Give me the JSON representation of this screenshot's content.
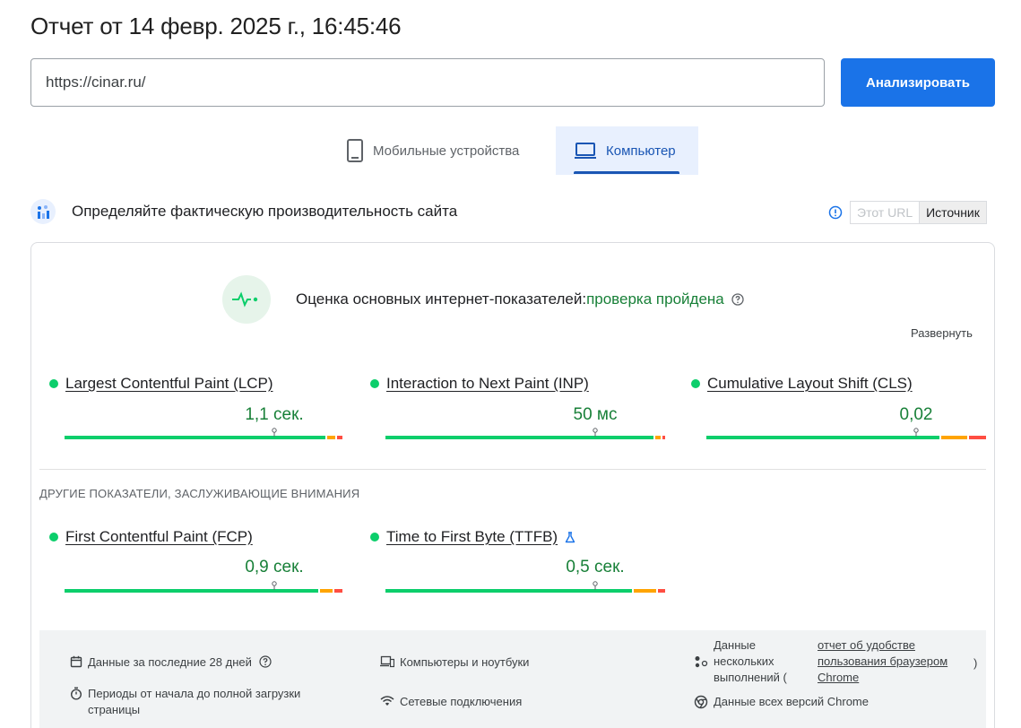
{
  "report": {
    "title": "Отчет от 14 февр. 2025 г., 16:45:46"
  },
  "search": {
    "url": "https://cinar.ru/",
    "analyze_label": "Анализировать"
  },
  "tabs": [
    {
      "label": "Мобильные устройства",
      "icon": "smartphone-icon",
      "active": false
    },
    {
      "label": "Компьютер",
      "icon": "laptop-icon",
      "active": true
    }
  ],
  "section": {
    "title": "Определяйте фактическую производительность сайта",
    "toggle": {
      "this_url": "Этот URL",
      "origin": "Источник",
      "selected": "Источник"
    }
  },
  "cwv": {
    "label": "Оценка основных интернет-показателей:",
    "status": "проверка пройдена",
    "expand": "Развернуть"
  },
  "metrics": [
    {
      "name": "Largest Contentful Paint (LCP)",
      "value": "1,1 сек.",
      "rating": "good",
      "marker_fraction": 0.75
    },
    {
      "name": "Interaction to Next Paint (INP)",
      "value": "50 мс",
      "rating": "good",
      "marker_fraction": 0.75
    },
    {
      "name": "Cumulative Layout Shift (CLS)",
      "value": "0,02",
      "rating": "good",
      "marker_fraction": 0.75
    }
  ],
  "other": {
    "label": "ДРУГИЕ ПОКАЗАТЕЛИ, ЗАСЛУЖИВАЮЩИЕ ВНИМАНИЯ",
    "metrics": [
      {
        "name": "First Contentful Paint (FCP)",
        "value": "0,9 сек.",
        "rating": "good",
        "marker_fraction": 0.75
      },
      {
        "name": "Time to First Byte (TTFB)",
        "value": "0,5 сек.",
        "rating": "good",
        "marker_fraction": 0.75,
        "experimental": true
      }
    ]
  },
  "footer": {
    "period": "Данные за последние 28 дней",
    "page_loads": "Периоды от начала до полной загрузки страницы",
    "devices": "Компьютеры и ноутбуки",
    "network": "Сетевые подключения",
    "samples_prefix": "Данные нескольких выполнений (",
    "samples_link": "отчет об удобстве пользования браузером Chrome",
    "samples_suffix": ")",
    "chrome_versions": "Данные всех версий Chrome"
  },
  "colors": {
    "accent": "#1a73e8",
    "good": "#0cce6b",
    "good_text": "#188038",
    "average": "#ffa400",
    "poor": "#ff4e42"
  }
}
